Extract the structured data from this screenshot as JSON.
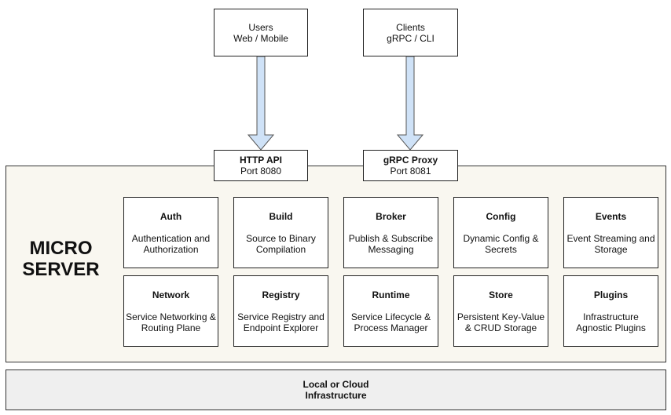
{
  "clients": [
    {
      "line1": "Users",
      "line2": "Web / Mobile"
    },
    {
      "line1": "Clients",
      "line2": "gRPC / CLI"
    }
  ],
  "gateways": [
    {
      "name": "HTTP API",
      "port": "Port 8080"
    },
    {
      "name": "gRPC Proxy",
      "port": "Port 8081"
    }
  ],
  "server": {
    "title_line1": "MICRO",
    "title_line2": "SERVER",
    "services": [
      {
        "name": "Auth",
        "desc1": "Authentication and",
        "desc2": "Authorization"
      },
      {
        "name": "Build",
        "desc1": "Source to Binary",
        "desc2": "Compilation"
      },
      {
        "name": "Broker",
        "desc1": "Publish & Subscribe",
        "desc2": "Messaging"
      },
      {
        "name": "Config",
        "desc1": "Dynamic Config &",
        "desc2": "Secrets"
      },
      {
        "name": "Events",
        "desc1": "Event Streaming and",
        "desc2": "Storage"
      },
      {
        "name": "Network",
        "desc1": "Service Networking &",
        "desc2": "Routing Plane"
      },
      {
        "name": "Registry",
        "desc1": "Service Registry and",
        "desc2": "Endpoint Explorer"
      },
      {
        "name": "Runtime",
        "desc1": "Service Lifecycle &",
        "desc2": "Process Manager"
      },
      {
        "name": "Store",
        "desc1": "Persistent Key-Value",
        "desc2": "& CRUD Storage"
      },
      {
        "name": "Plugins",
        "desc1": "Infrastructure",
        "desc2": "Agnostic Plugins"
      }
    ]
  },
  "infrastructure": {
    "line1": "Local or Cloud",
    "line2": "Infrastructure"
  },
  "colors": {
    "arrow_fill": "#cfe2f7",
    "server_bg": "#f9f7f0",
    "infra_bg": "#efefef"
  }
}
